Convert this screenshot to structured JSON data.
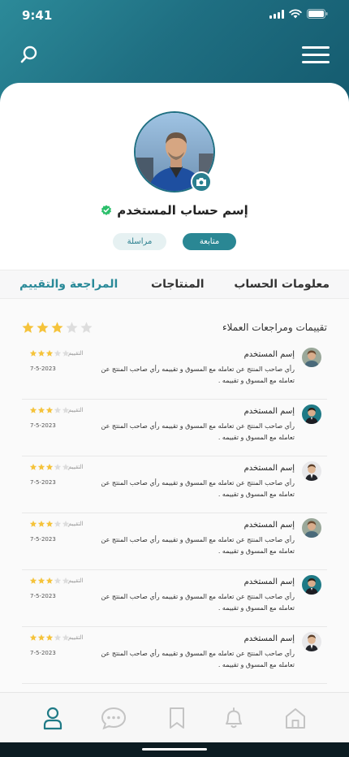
{
  "status_bar": {
    "time": "9:41"
  },
  "profile": {
    "username": "إسم حساب المستخدم",
    "follow_label": "متابعة",
    "message_label": "مراسلة"
  },
  "tabs": [
    {
      "label": "معلومات الحساب",
      "active": false
    },
    {
      "label": "المنتاجات",
      "active": false
    },
    {
      "label": "المراجعة والتقييم",
      "active": true
    }
  ],
  "reviews_section": {
    "title": "تقييمات ومراجعات العملاء",
    "overall_rating": 3,
    "max_rating": 5
  },
  "reviews": [
    {
      "name": "إسم المستخدم",
      "text": "رأي صاحب المنتج عن تعامله مع المسوق و تقييمه رأي صاحب المنتج عن تعامله مع المسوق و تقييمه .",
      "rating_label": "التقييم",
      "rating": 3,
      "date": "7-5-2023"
    },
    {
      "name": "إسم المستخدم",
      "text": "رأي صاحب المنتج عن تعامله مع المسوق و تقييمه رأي صاحب المنتج عن تعامله مع المسوق و تقييمه .",
      "rating_label": "التقييم",
      "rating": 3,
      "date": "7-5-2023"
    },
    {
      "name": "إسم المستخدم",
      "text": "رأي صاحب المنتج عن تعامله مع المسوق و تقييمه رأي صاحب المنتج عن تعامله مع المسوق و تقييمه .",
      "rating_label": "التقييم",
      "rating": 3,
      "date": "7-5-2023"
    },
    {
      "name": "إسم المستخدم",
      "text": "رأي صاحب المنتج عن تعامله مع المسوق و تقييمه رأي صاحب المنتج عن تعامله مع المسوق و تقييمه .",
      "rating_label": "التقييم",
      "rating": 3,
      "date": "7-5-2023"
    },
    {
      "name": "إسم المستخدم",
      "text": "رأي صاحب المنتج عن تعامله مع المسوق و تقييمه رأي صاحب المنتج عن تعامله مع المسوق و تقييمه .",
      "rating_label": "التقييم",
      "rating": 3,
      "date": "7-5-2023"
    },
    {
      "name": "إسم المستخدم",
      "text": "رأي صاحب المنتج عن تعامله مع المسوق و تقييمه رأي صاحب المنتج عن تعامله مع المسوق و تقييمه .",
      "rating_label": "التقييم",
      "rating": 3,
      "date": "7-5-2023"
    }
  ],
  "bottom_nav": {
    "items": [
      {
        "icon": "user-icon",
        "active": true
      },
      {
        "icon": "chat-icon",
        "active": false
      },
      {
        "icon": "bookmark-icon",
        "active": false
      },
      {
        "icon": "bell-icon",
        "active": false
      },
      {
        "icon": "home-icon",
        "active": false
      }
    ]
  },
  "colors": {
    "brand": "#2a8794",
    "header_dark": "#145a6e",
    "star_filled": "#f5c33b",
    "star_empty": "#dddddd",
    "verified": "#2bbf6b"
  }
}
